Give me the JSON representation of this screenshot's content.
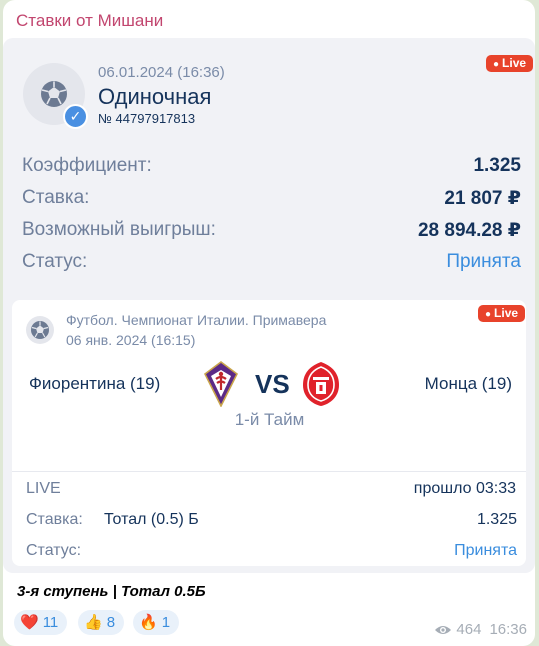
{
  "channel_name": "Ставки от Мишани",
  "bet": {
    "live_badge": "Live",
    "date": "06.01.2024 (16:36)",
    "type": "Одиночная",
    "number": "№ 44797917813",
    "rows": [
      {
        "label": "Коэффициент:",
        "value": "1.325"
      },
      {
        "label": "Ставка:",
        "value": "21 807 ₽"
      },
      {
        "label": "Возможный выигрыш:",
        "value": "28 894.28 ₽"
      },
      {
        "label": "Статус:",
        "value": "Принята"
      }
    ]
  },
  "event": {
    "live_badge": "Live",
    "league": "Футбол. Чемпионат Италии. Примавера",
    "date": "06 янв. 2024 (16:15)",
    "team1": "Фиорентина (19)",
    "vs": "VS",
    "team2": "Монца (19)",
    "period": "1-й Тайм",
    "live_label": "LIVE",
    "elapsed": "прошло 03:33",
    "stake_label": "Ставка:",
    "stake_market": "Тотал (0.5) Б",
    "stake_odds": "1.325",
    "status_label": "Статус:",
    "status_value": "Принята"
  },
  "caption": "3-я ступень | Тотал 0.5Б",
  "reactions": [
    {
      "emoji": "❤️",
      "count": "11",
      "icon": "heart-icon"
    },
    {
      "emoji": "👍",
      "count": "8",
      "icon": "thumbs-up-icon"
    },
    {
      "emoji": "🔥",
      "count": "1",
      "icon": "fire-icon"
    }
  ],
  "views": "464",
  "time": "16:36",
  "colors": {
    "accent": "#3a8dde",
    "live": "#e8432b",
    "channel": "#c2466f",
    "dark_text": "#15335b"
  }
}
